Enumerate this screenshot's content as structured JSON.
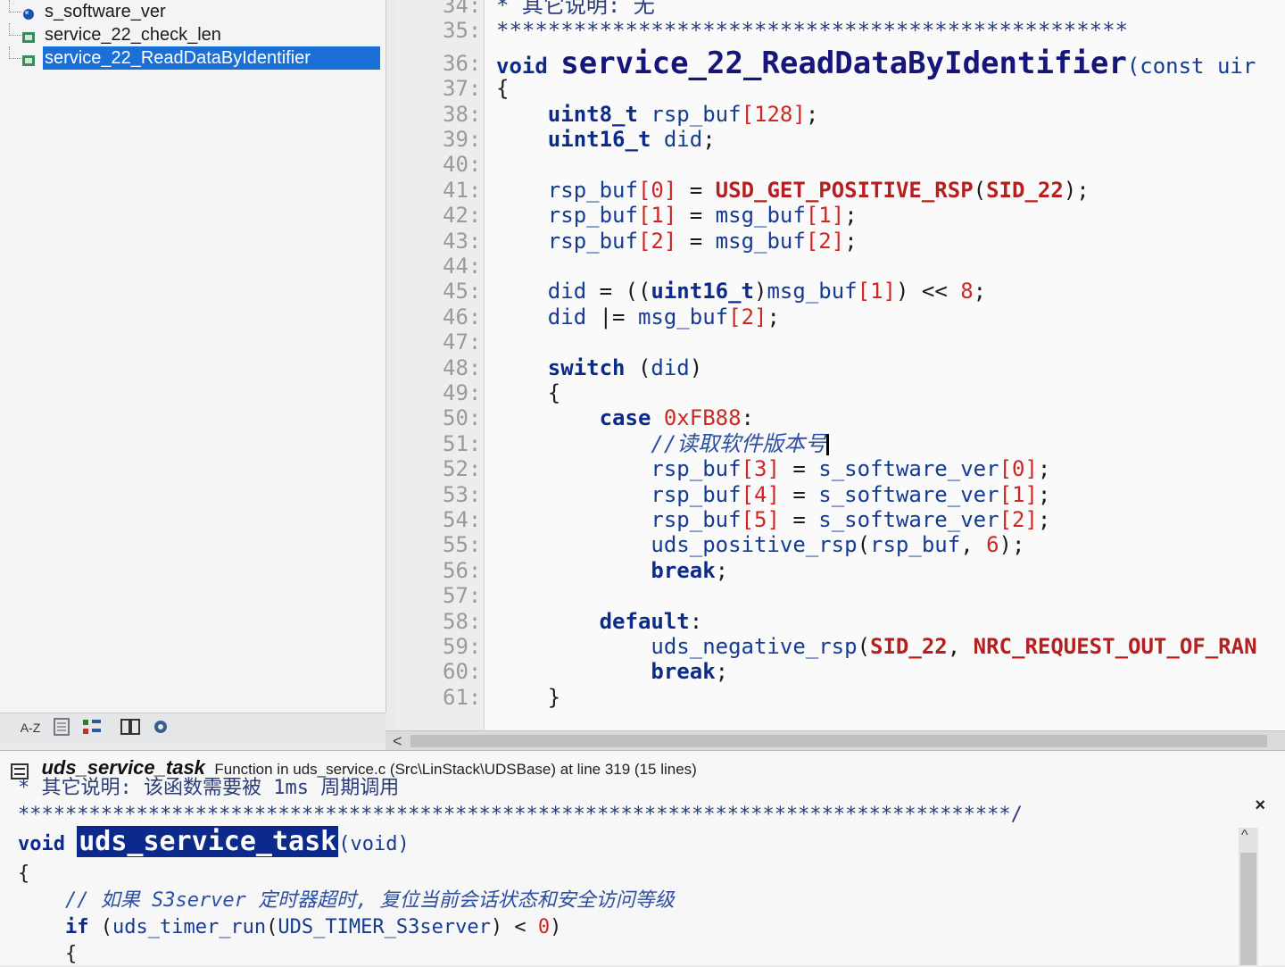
{
  "symbols": [
    {
      "label": "s_software_ver",
      "icon": "variable-icon"
    },
    {
      "label": "service_22_check_len",
      "icon": "function-icon"
    },
    {
      "label": "service_22_ReadDataByIdentifier",
      "icon": "function-icon",
      "selected": true
    }
  ],
  "left_toolbar": {
    "sort_label": "A-Z",
    "icons": [
      "list-icon",
      "tree-icon",
      "book-icon",
      "gear-icon"
    ]
  },
  "editor": {
    "lines": [
      {
        "n": "34:",
        "code": "* 其它说明: 无"
      },
      {
        "n": "35:",
        "code": "*************************************************"
      },
      {
        "n": "36:",
        "pre": "void ",
        "fn": "service_22_ReadDataByIdentifier",
        "post": "(const uir"
      },
      {
        "n": "37:",
        "code": "{"
      },
      {
        "n": "38:",
        "code": "    uint8_t rsp_buf[128];"
      },
      {
        "n": "39:",
        "code": "    uint16_t did;"
      },
      {
        "n": "40:",
        "code": ""
      },
      {
        "n": "41:",
        "code": "    rsp_buf[0] = USD_GET_POSITIVE_RSP(SID_22);"
      },
      {
        "n": "42:",
        "code": "    rsp_buf[1] = msg_buf[1];"
      },
      {
        "n": "43:",
        "code": "    rsp_buf[2] = msg_buf[2];"
      },
      {
        "n": "44:",
        "code": ""
      },
      {
        "n": "45:",
        "code": "    did = ((uint16_t)msg_buf[1]) << 8;"
      },
      {
        "n": "46:",
        "code": "    did |= msg_buf[2];"
      },
      {
        "n": "47:",
        "code": ""
      },
      {
        "n": "48:",
        "code": "    switch (did)"
      },
      {
        "n": "49:",
        "code": "    {"
      },
      {
        "n": "50:",
        "code": "        case 0xFB88:"
      },
      {
        "n": "51:",
        "code": "            //读取软件版本号"
      },
      {
        "n": "52:",
        "code": "            rsp_buf[3] = s_software_ver[0];"
      },
      {
        "n": "53:",
        "code": "            rsp_buf[4] = s_software_ver[1];"
      },
      {
        "n": "54:",
        "code": "            rsp_buf[5] = s_software_ver[2];"
      },
      {
        "n": "55:",
        "code": "            uds_positive_rsp(rsp_buf, 6);"
      },
      {
        "n": "56:",
        "code": "            break;"
      },
      {
        "n": "57:",
        "code": ""
      },
      {
        "n": "58:",
        "code": "        default:"
      },
      {
        "n": "59:",
        "code": "            uds_negative_rsp(SID_22, NRC_REQUEST_OUT_OF_RAN"
      },
      {
        "n": "60:",
        "code": "            break;"
      },
      {
        "n": "61:",
        "code": "    }"
      }
    ]
  },
  "context": {
    "name": "uds_service_task",
    "description": "Function in uds_service.c (Src\\LinStack\\UDSBase) at line 319 (15 lines)",
    "close_label": "×",
    "lines": [
      {
        "code": "* 其它说明: 该函数需要被 1ms 周期调用"
      },
      {
        "code": "************************************************************************************/"
      },
      {
        "pre": "void ",
        "hl": "uds_service_task",
        "post": "(void)"
      },
      {
        "code": "{"
      },
      {
        "code": "    // 如果 S3server 定时器超时, 复位当前会话状态和安全访问等级"
      },
      {
        "code": "    if (uds_timer_run(UDS_TIMER_S3server) < 0)"
      },
      {
        "code": "    {"
      }
    ]
  },
  "colors": {
    "selection": "#1c6fd6",
    "keyword": "#0c2a8c",
    "number": "#d02525"
  }
}
